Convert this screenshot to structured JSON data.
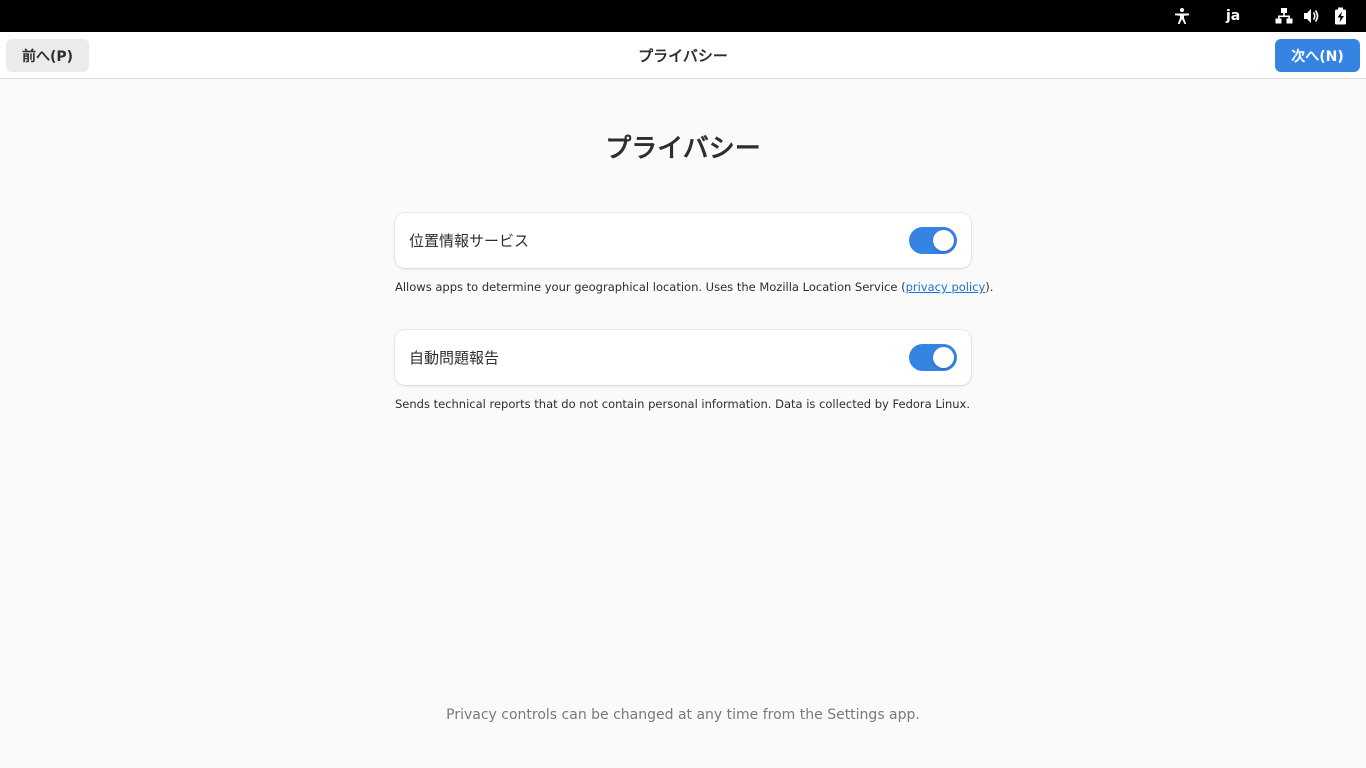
{
  "system_tray": {
    "accessibility_icon": "accessibility-icon",
    "language": "ja",
    "network_icon": "network-wired-icon",
    "volume_icon": "speaker-volume-icon",
    "battery_icon": "battery-charging-icon"
  },
  "header": {
    "prev_label": "前へ(P)",
    "title": "プライバシー",
    "next_label": "次へ(N)"
  },
  "main": {
    "heading": "プライバシー",
    "location": {
      "label": "位置情報サービス",
      "enabled": true,
      "desc_prefix": "Allows apps to determine your geographical location. Uses the Mozilla Location Service (",
      "link_text": "privacy policy",
      "desc_suffix": ")."
    },
    "problem_reporting": {
      "label": "自動問題報告",
      "enabled": true,
      "description": "Sends technical reports that do not contain personal information. Data is collected by Fedora Linux."
    }
  },
  "footer": {
    "note": "Privacy controls can be changed at any time from the Settings app."
  },
  "colors": {
    "accent": "#3584e4",
    "link": "#1c71d8",
    "topbar": "#000000"
  }
}
